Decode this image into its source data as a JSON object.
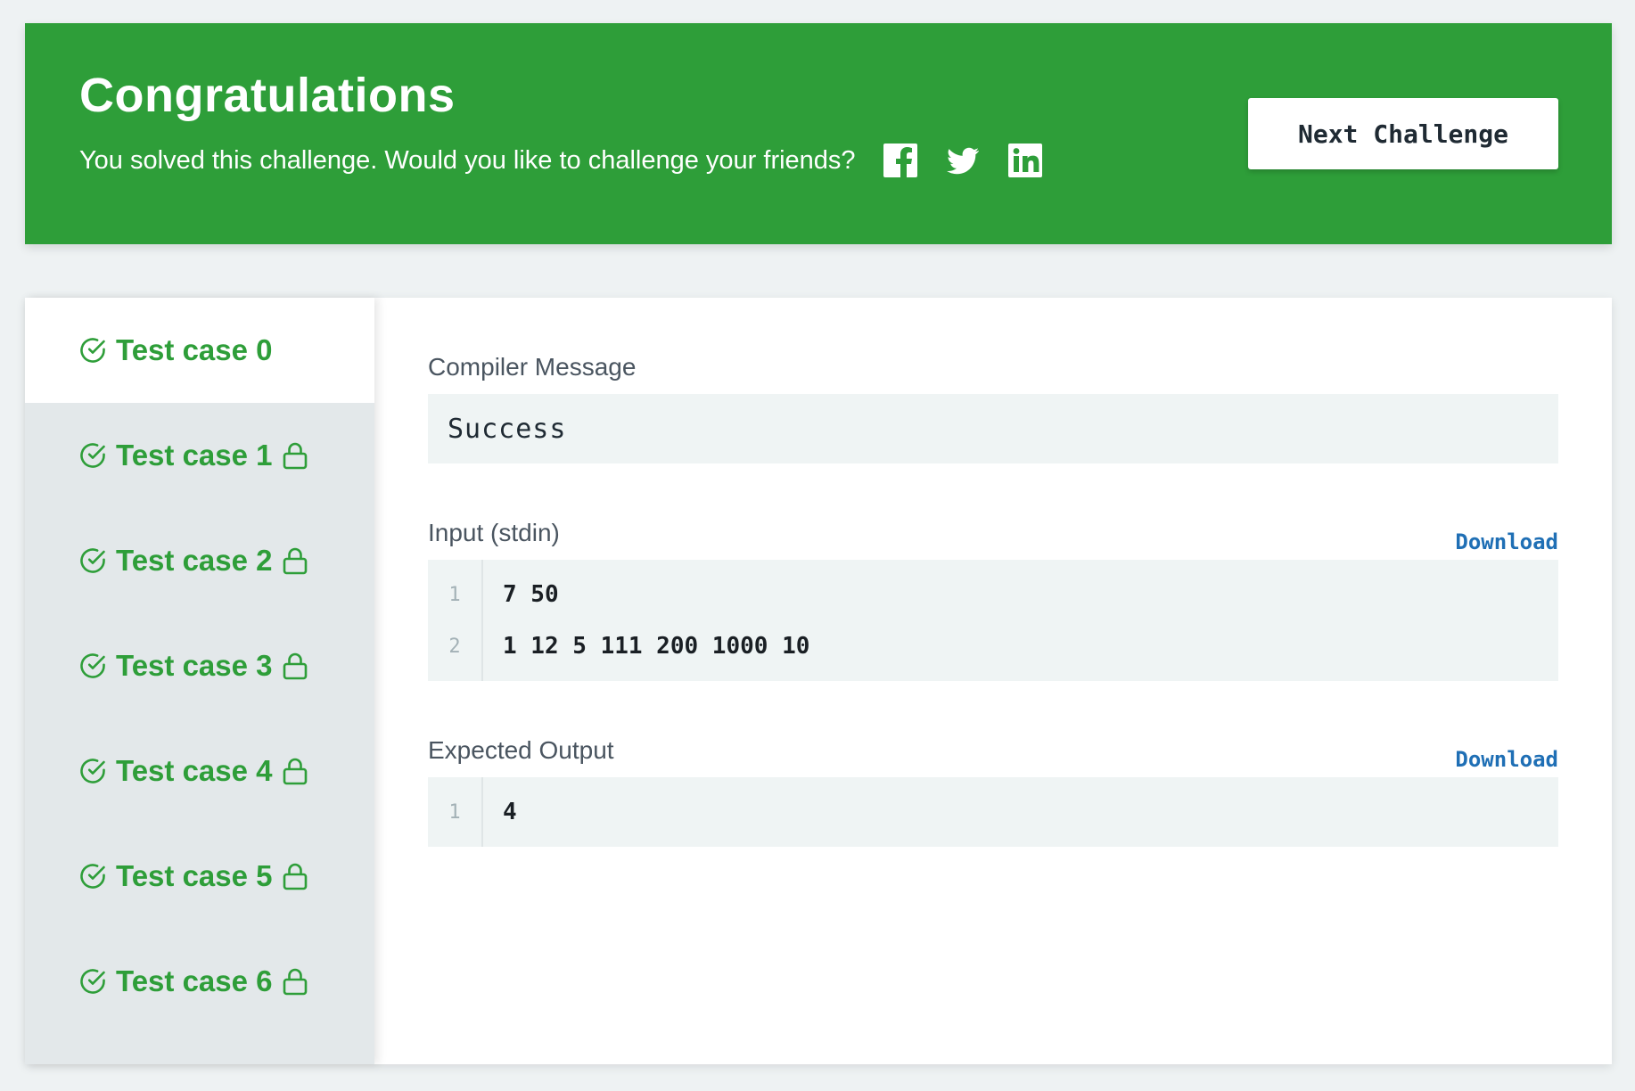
{
  "banner": {
    "title": "Congratulations",
    "subtitle": "You solved this challenge. Would you like to challenge your friends?",
    "social_icons": [
      "facebook-icon",
      "twitter-icon",
      "linkedin-icon"
    ],
    "next_button": "Next Challenge",
    "background_color": "#2e9e39"
  },
  "test_cases": [
    {
      "label": "Test case 0",
      "passed": true,
      "locked": false,
      "active": true
    },
    {
      "label": "Test case 1",
      "passed": true,
      "locked": true,
      "active": false
    },
    {
      "label": "Test case 2",
      "passed": true,
      "locked": true,
      "active": false
    },
    {
      "label": "Test case 3",
      "passed": true,
      "locked": true,
      "active": false
    },
    {
      "label": "Test case 4",
      "passed": true,
      "locked": true,
      "active": false
    },
    {
      "label": "Test case 5",
      "passed": true,
      "locked": true,
      "active": false
    },
    {
      "label": "Test case 6",
      "passed": true,
      "locked": true,
      "active": false
    }
  ],
  "compiler": {
    "label": "Compiler Message",
    "message": "Success"
  },
  "input": {
    "label": "Input (stdin)",
    "download": "Download",
    "lines": [
      {
        "no": "1",
        "text": "7 50"
      },
      {
        "no": "2",
        "text": "1 12 5 111 200 1000 10"
      }
    ]
  },
  "expected": {
    "label": "Expected Output",
    "download": "Download",
    "lines": [
      {
        "no": "1",
        "text": "4"
      }
    ]
  },
  "colors": {
    "success_green": "#2e9e39",
    "link_blue": "#1f6fb5"
  }
}
